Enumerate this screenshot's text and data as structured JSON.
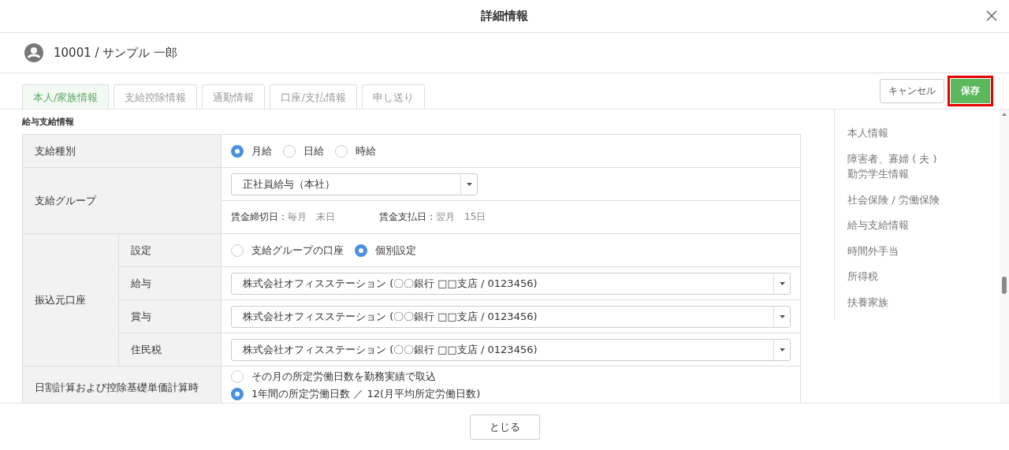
{
  "dialog": {
    "title": "詳細情報"
  },
  "employee": {
    "label": "10001 / サンプル 一郎"
  },
  "tabs": [
    {
      "label": "本人/家族情報",
      "selected": true
    },
    {
      "label": "支給控除情報",
      "selected": false
    },
    {
      "label": "通勤情報",
      "selected": false
    },
    {
      "label": "口座/支払情報",
      "selected": false
    },
    {
      "label": "申し送り",
      "selected": false
    }
  ],
  "actions": {
    "cancel": "キャンセル",
    "save": "保存",
    "save_highlighted": true
  },
  "section": {
    "title": "給与支給情報",
    "rows": [
      {
        "kind": "radio",
        "label": "支給種別",
        "options": [
          {
            "label": "月給",
            "selected": true
          },
          {
            "label": "日給",
            "selected": false
          },
          {
            "label": "時給",
            "selected": false
          }
        ]
      },
      {
        "kind": "select",
        "label": "支給グループ",
        "value": "正社員給与（本社）",
        "notes": [
          {
            "label": "賃金締切日：",
            "value": "毎月　末日"
          },
          {
            "label": "賃金支払日：",
            "value": "翌月　15日"
          }
        ]
      },
      {
        "kind": "group",
        "label": "振込元口座",
        "children": [
          {
            "kind": "radio",
            "label": "設定",
            "options": [
              {
                "label": "支給グループの口座",
                "selected": false
              },
              {
                "label": "個別設定",
                "selected": true
              }
            ]
          },
          {
            "kind": "select",
            "label": "給与",
            "value": "株式会社オフィスステーション (〇〇銀行 □□支店 / 0123456)"
          },
          {
            "kind": "select",
            "label": "賞与",
            "value": "株式会社オフィスステーション (〇〇銀行 □□支店 / 0123456)"
          },
          {
            "kind": "select",
            "label": "住民税",
            "value": "株式会社オフィスステーション (〇〇銀行 □□支店 / 0123456)"
          }
        ]
      },
      {
        "kind": "radio_stack",
        "label": "日割計算および控除基礎単価計算時",
        "options": [
          {
            "label": "その月の所定労働日数を勤務実績で取込",
            "selected": false
          },
          {
            "label": "1年間の所定労働日数 ／ 12(月平均所定労働日数)",
            "selected": true
          }
        ]
      }
    ]
  },
  "nav": {
    "items": [
      {
        "lines": [
          "本人情報"
        ]
      },
      {
        "lines": [
          "障害者、寡婦 ( 夫 )",
          "勤労学生情報"
        ]
      },
      {
        "lines": [
          "社会保険 / 労働保険"
        ]
      },
      {
        "lines": [
          "給与支給情報"
        ]
      },
      {
        "lines": [
          "時間外手当"
        ]
      },
      {
        "lines": [
          "所得税"
        ]
      },
      {
        "lines": [
          "扶養家族"
        ]
      }
    ]
  },
  "footer": {
    "close": "とじる"
  }
}
